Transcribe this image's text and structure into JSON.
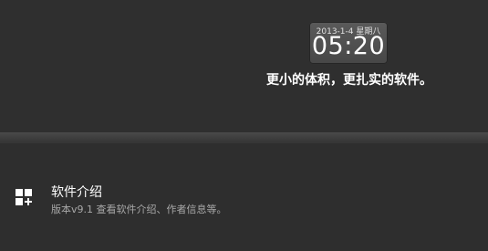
{
  "header": {
    "clock": {
      "date": "2013-1-4 星期八",
      "time": "05:20"
    },
    "slogan": "更小的体积，更扎实的软件。"
  },
  "menu": {
    "items": [
      {
        "icon": "apps-icon",
        "title": "软件介绍",
        "subtitle": "版本v9.1  查看软件介绍、作者信息等。"
      }
    ]
  }
}
